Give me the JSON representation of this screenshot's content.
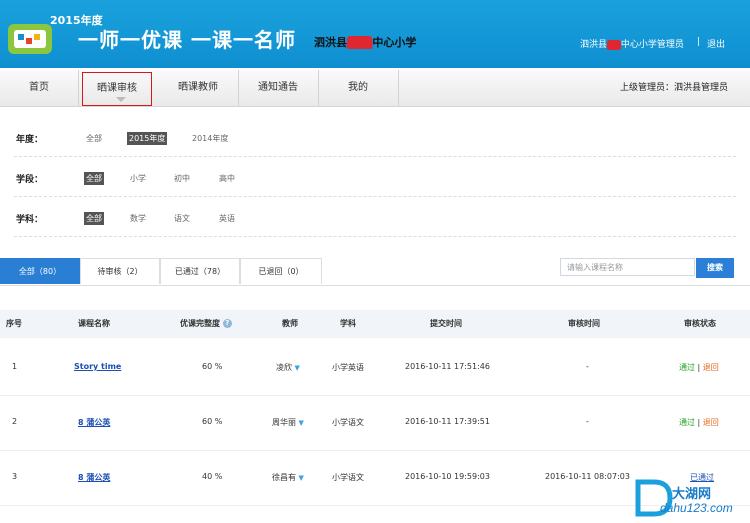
{
  "header": {
    "year": "2015年度",
    "slogan": "一师一优课 一课一名师",
    "school_pre": "泗洪县",
    "school_post": "中心小学",
    "user_pre": "泗洪县",
    "user_post": "中心小学管理员",
    "separator": "|",
    "logout": "退出"
  },
  "nav": {
    "items": [
      "首页",
      "晒课审核",
      "晒课教师",
      "通知通告",
      "我的"
    ],
    "active_index": 1,
    "superior": "上级管理员：泗洪县管理员"
  },
  "filters": [
    {
      "label": "年度：",
      "options": [
        "全部",
        "2015年度",
        "2014年度"
      ],
      "selected": 1
    },
    {
      "label": "学段：",
      "options": [
        "全部",
        "小学",
        "初中",
        "高中"
      ],
      "selected": 0
    },
    {
      "label": "学科：",
      "options": [
        "全部",
        "数学",
        "语文",
        "英语"
      ],
      "selected": 0
    }
  ],
  "tabs": [
    "全部（80）",
    "待审核（2）",
    "已通过（78）",
    "已退回（0）"
  ],
  "search": {
    "placeholder": "请输入课程名称",
    "button": "搜索"
  },
  "table": {
    "headers": [
      "序号",
      "课程名称",
      "优课完整度",
      "教师",
      "学科",
      "提交时间",
      "审核时间",
      "审核状态"
    ],
    "rows": [
      {
        "no": "1",
        "course": "Story time",
        "complete": "60 %",
        "teacher": "凌欣",
        "subject": "小学英语",
        "submitted": "2016-10-11 17:51:46",
        "reviewed": "-",
        "pass": "通过",
        "sep": "|",
        "reject": "退回"
      },
      {
        "no": "2",
        "course": "8 蒲公英",
        "complete": "60 %",
        "teacher": "周华丽",
        "subject": "小学语文",
        "submitted": "2016-10-11 17:39:51",
        "reviewed": "-",
        "pass": "通过",
        "sep": "|",
        "reject": "退回"
      },
      {
        "no": "3",
        "course": "8 蒲公英",
        "complete": "40 %",
        "teacher": "徐昌有",
        "subject": "小学语文",
        "submitted": "2016-10-10 19:59:03",
        "reviewed": "2016-10-11 08:07:03",
        "status": "已通过"
      }
    ]
  },
  "watermark": {
    "brand": "大湖网",
    "url": "dahu123.com"
  }
}
